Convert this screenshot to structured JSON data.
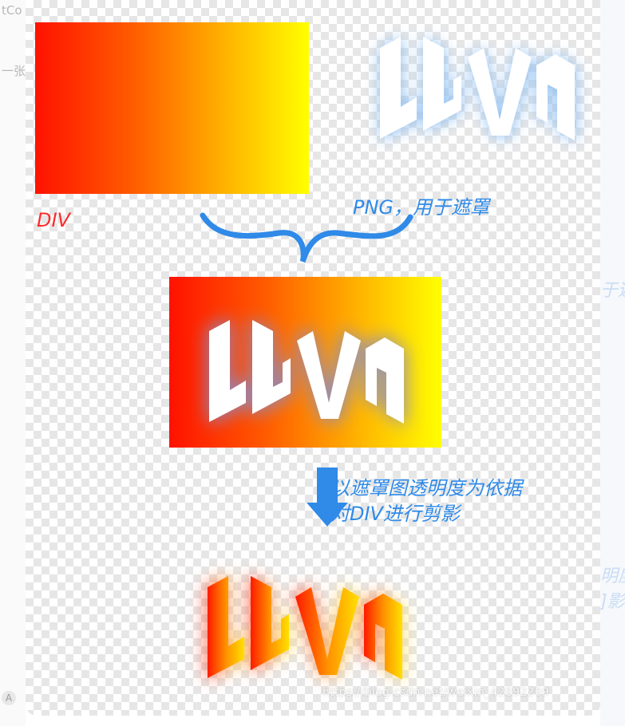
{
  "background": {
    "left_fragments": [
      "tCo",
      "一张"
    ],
    "right_fragments": [
      "于遮",
      "明度",
      "]影"
    ]
  },
  "figure": {
    "div_label": "DIV",
    "png_label": "PNG，用于遮罩",
    "step_label_line1": "以遮罩图透明度为依据",
    "step_label_line2": "对DIV进行剪影",
    "watermark": "https://blog.csdn.net/weixin_42892269"
  },
  "colors": {
    "gradient_start": "#ff1200",
    "gradient_end": "#ffff00",
    "div_label": "#ff2a2a",
    "annotation": "#2f8ae8",
    "mask_glow": "#8fc0f2",
    "arrow": "#2f8ae8"
  },
  "icons": {
    "brace": "curly-brace-icon",
    "arrow": "down-arrow-icon",
    "logo": "lavas-logo-icon"
  }
}
